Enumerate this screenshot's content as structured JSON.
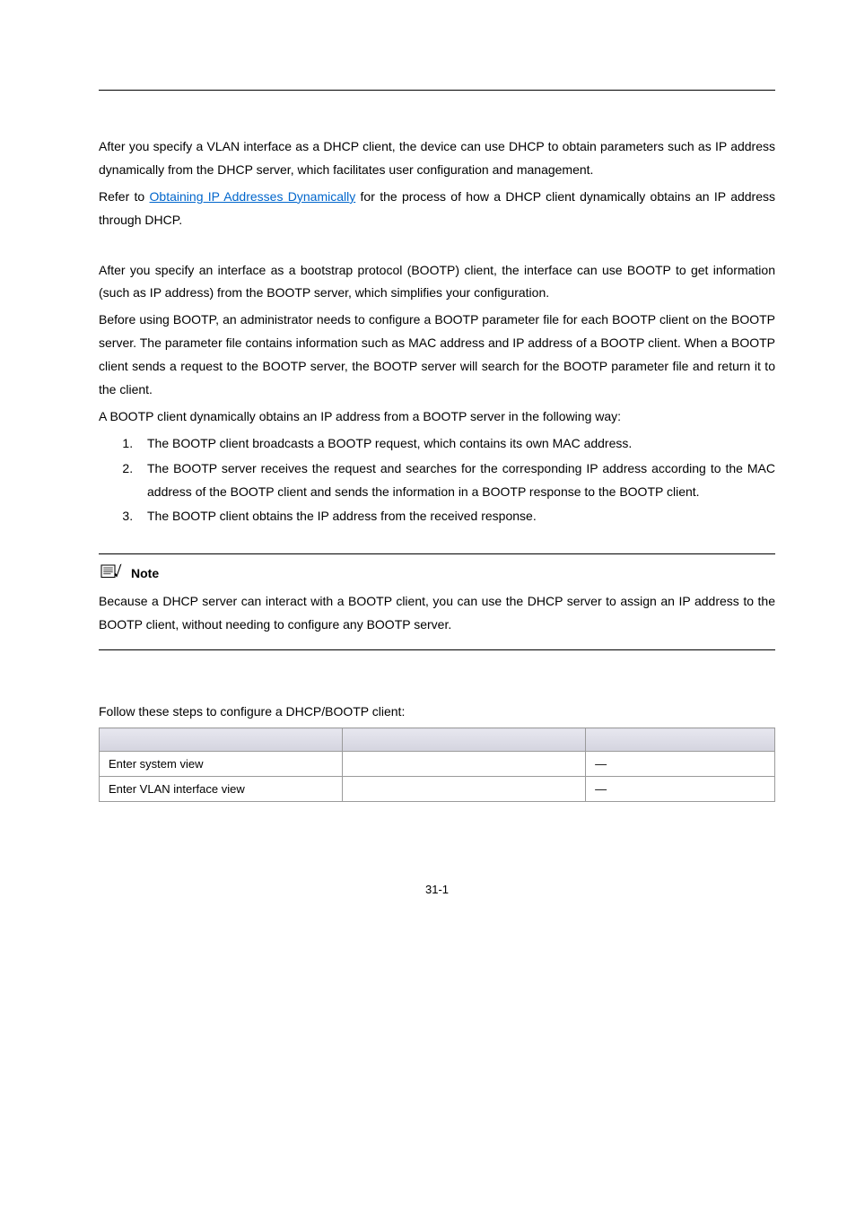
{
  "section": {
    "dhcp_client": {
      "p1": "After you specify a VLAN interface as a DHCP client, the device can use DHCP to obtain parameters such as IP address dynamically from the DHCP server, which facilitates user configuration and management.",
      "p2_pre": "Refer to ",
      "p2_link": "Obtaining IP Addresses Dynamically",
      "p2_post": " for the process of how a DHCP client dynamically obtains an IP address through DHCP."
    },
    "bootp_client": {
      "p1": "After you specify an interface as a bootstrap protocol (BOOTP) client, the interface can use BOOTP to get information (such as IP address) from the BOOTP server, which simplifies your configuration.",
      "p2": "Before using BOOTP, an administrator needs to configure a BOOTP parameter file for each BOOTP client on the BOOTP server. The parameter file contains information such as MAC address and IP address of a BOOTP client. When a BOOTP client sends a request to the BOOTP server, the BOOTP server will search for the BOOTP parameter file and return it to the client.",
      "p3": "A BOOTP client dynamically obtains an IP address from a BOOTP server in the following way:",
      "list": {
        "i1": "The BOOTP client broadcasts a BOOTP request, which contains its own MAC address.",
        "i2": "The BOOTP server receives the request and searches for the corresponding IP address according to the MAC address of the BOOTP client and sends the information in a BOOTP response to the BOOTP client.",
        "i3": "The BOOTP client obtains the IP address from the received response."
      }
    },
    "note": {
      "label": "Note",
      "body": "Because a DHCP server can interact with a BOOTP client, you can use the DHCP server to assign an IP address to the BOOTP client, without needing to configure any BOOTP server."
    },
    "config": {
      "caption": "Follow these steps to configure a DHCP/BOOTP client:",
      "rows": {
        "r1c1": "Enter system view",
        "r1c2": "",
        "r1c3": "—",
        "r2c1": "Enter VLAN interface view",
        "r2c2": "",
        "r2c3": "—"
      }
    }
  },
  "page_number": "31-1"
}
